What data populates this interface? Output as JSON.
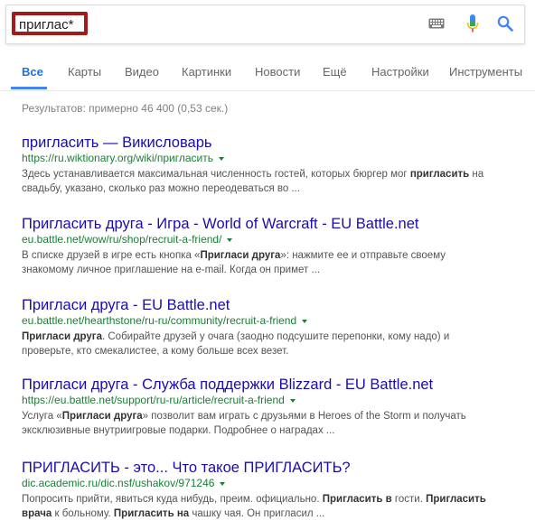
{
  "search": {
    "query": "приглас*"
  },
  "icons": {
    "keyboard": "keyboard-icon",
    "mic": "microphone-icon",
    "search": "search-icon"
  },
  "colors": {
    "highlight_border": "#a31a1a",
    "link": "#1a0dab",
    "url": "#1a7e34",
    "active_tab": "#1a73e8"
  },
  "tabs": [
    {
      "label": "Все",
      "active": true
    },
    {
      "label": "Карты"
    },
    {
      "label": "Видео"
    },
    {
      "label": "Картинки"
    },
    {
      "label": "Новости"
    },
    {
      "label": "Ещё"
    },
    {
      "label": "Настройки"
    },
    {
      "label": "Инструменты"
    }
  ],
  "stats": "Результатов: примерно 46 400 (0,53 сек.) ",
  "results": [
    {
      "title": "пригласить — Викисловарь",
      "url": "https://ru.wiktionary.org/wiki/пригласить",
      "snippet_lines": [
        [
          {
            "t": "Здесь устанавливается максимальная численность гостей, которых бюргер мог "
          },
          {
            "t": "пригласить",
            "b": true
          },
          {
            "t": " на"
          }
        ],
        [
          {
            "t": "свадьбу, указано, сколько раз можно переодеваться во ..."
          }
        ]
      ]
    },
    {
      "title": "Пригласить друга - Игра - World of Warcraft - EU Battle.net",
      "url": "eu.battle.net/wow/ru/shop/recruit-a-friend/",
      "snippet_lines": [
        [
          {
            "t": "В списке друзей в игре есть кнопка «"
          },
          {
            "t": "Пригласи друга",
            "b": true
          },
          {
            "t": "»: нажмите ее и отправьте своему"
          }
        ],
        [
          {
            "t": "знакомому личное приглашение на e-mail. Когда он примет ..."
          }
        ]
      ]
    },
    {
      "title": "Пригласи друга - EU Battle.net",
      "url": "eu.battle.net/hearthstone/ru-ru/community/recruit-a-friend",
      "snippet_lines": [
        [
          {
            "t": "Пригласи друга",
            "b": true
          },
          {
            "t": ". Собирайте друзей у очага (заодно подсушите перепонки, кому надо) и"
          }
        ],
        [
          {
            "t": "проверьте, кто смекалистее, а кому больше всех везет."
          }
        ]
      ]
    },
    {
      "title": "Пригласи друга - Служба поддержки Blizzard - EU Battle.net",
      "url": "https://eu.battle.net/support/ru-ru/article/recruit-a-friend",
      "snippet_lines": [
        [
          {
            "t": "Услуга «"
          },
          {
            "t": "Пригласи друга",
            "b": true
          },
          {
            "t": "» позволит вам играть с друзьями в Heroes of the Storm и получать"
          }
        ],
        [
          {
            "t": "эксклюзивные внутриигровые подарки. Подробнее о наградах ..."
          }
        ]
      ]
    },
    {
      "title": "ПРИГЛАСИТЬ - это... Что такое ПРИГЛАСИТЬ?",
      "url": "dic.academic.ru/dic.nsf/ushakov/971246",
      "snippet_lines": [
        [
          {
            "t": "Попросить прийти, явиться куда нибудь, преим. официально. "
          },
          {
            "t": "Пригласить в",
            "b": true
          },
          {
            "t": " гости. "
          },
          {
            "t": "Пригласить",
            "b": true
          }
        ],
        [
          {
            "t": "врача",
            "b": true
          },
          {
            "t": " к больному. "
          },
          {
            "t": "Пригласить на",
            "b": true
          },
          {
            "t": " чашку чая. Он пригласил ..."
          }
        ]
      ]
    }
  ]
}
